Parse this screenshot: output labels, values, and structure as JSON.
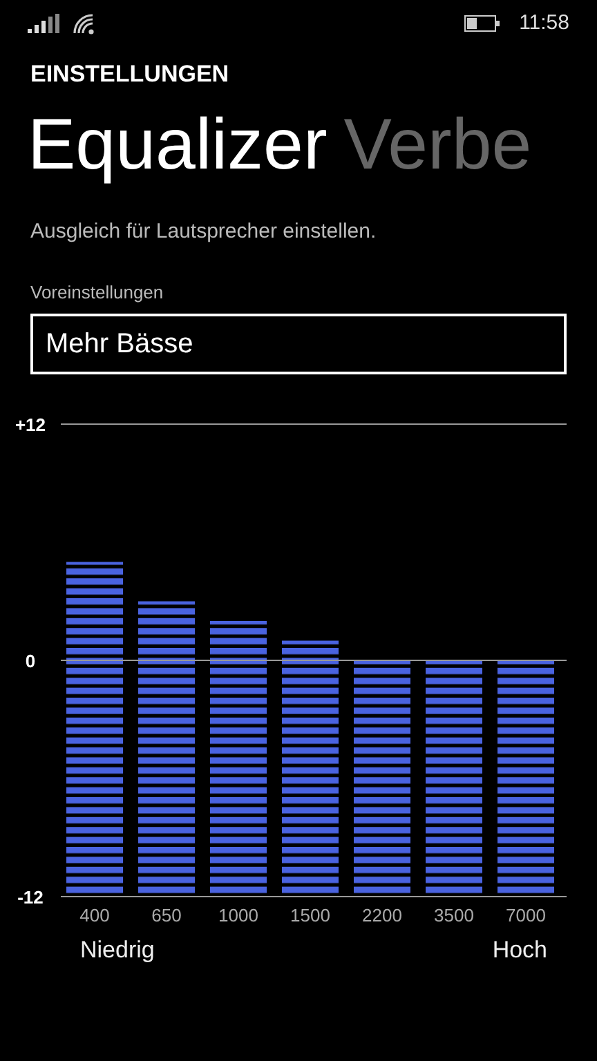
{
  "status_bar": {
    "time": "11:58"
  },
  "header": {
    "title": "EINSTELLUNGEN"
  },
  "pivots": [
    {
      "label": "Equalizer",
      "selected": true
    },
    {
      "label": "Verbe",
      "selected": false
    }
  ],
  "description": "Ausgleich für Lautsprecher einstellen.",
  "preset": {
    "label": "Voreinstellungen",
    "value": "Mehr Bässe"
  },
  "equalizer": {
    "chart_data": {
      "type": "bar",
      "categories": [
        "400",
        "650",
        "1000",
        "1500",
        "2200",
        "3500",
        "7000"
      ],
      "stacked": true,
      "series": [
        {
          "color": "#4a63e0",
          "values": [
            -12,
            -12,
            -12,
            -12,
            -12,
            -12,
            -12
          ]
        },
        {
          "color": "#4a63e0",
          "values": [
            5,
            3,
            2,
            1,
            0,
            0,
            0
          ]
        }
      ],
      "ylim": [
        -12,
        12
      ],
      "yticks": [
        {
          "value": 12,
          "label": "+12"
        },
        0,
        -12
      ]
    },
    "low_label": "Niedrig",
    "high_label": "Hoch"
  }
}
